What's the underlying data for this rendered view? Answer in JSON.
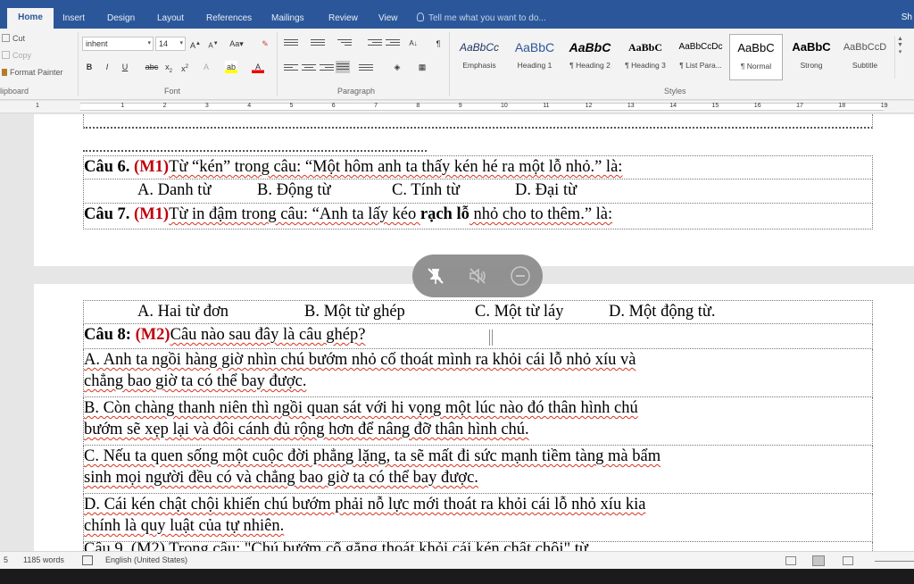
{
  "ribbon": {
    "tabs": [
      "Home",
      "Insert",
      "Design",
      "Layout",
      "References",
      "Mailings",
      "Review",
      "View"
    ],
    "active_tab": "Home",
    "tell_me": "Tell me what you want to do...",
    "share": "Sh",
    "clipboard": {
      "cut": "Cut",
      "copy": "Copy",
      "format_painter": "Format Painter",
      "label": "lipboard"
    },
    "font": {
      "name": "inhent",
      "size": "14",
      "label": "Font"
    },
    "paragraph": {
      "label": "Paragraph"
    },
    "styles": {
      "label": "Styles",
      "items": [
        {
          "preview": "AaBbCc",
          "name": "Emphasis"
        },
        {
          "preview": "AaBbC",
          "name": "Heading 1"
        },
        {
          "preview": "AaBbC",
          "name": "¶ Heading 2"
        },
        {
          "preview": "AaBbC",
          "name": "¶ Heading 3"
        },
        {
          "preview": "AaBbCcDc",
          "name": "¶ List Para..."
        },
        {
          "preview": "AaBbC",
          "name": "¶ Normal"
        },
        {
          "preview": "AaBbC",
          "name": "Strong"
        },
        {
          "preview": "AaBbCcD",
          "name": "Subtitle"
        }
      ],
      "selected": "¶ Normal"
    }
  },
  "ruler": {
    "numbers": [
      "1",
      "1",
      "2",
      "3",
      "4",
      "5",
      "6",
      "7",
      "8",
      "9",
      "10",
      "11",
      "12",
      "13",
      "14",
      "15",
      "16",
      "17",
      "18",
      "19"
    ]
  },
  "document": {
    "q6": {
      "prefix": "Câu 6. ",
      "level": "(M1)",
      "text": "Từ “kén” trong câu: “Một hôm anh ta thấy kén hé ra một lỗ nhỏ.” là:",
      "options": [
        "A. Danh từ",
        "B. Động từ",
        "C. Tính từ",
        "D. Đại từ"
      ]
    },
    "q7": {
      "prefix": "Câu 7. ",
      "level": "(M1)",
      "text_before": "Từ in đậm trong câu: “Anh ta lấy kéo ",
      "bold_text": "rạch lỗ",
      "text_after": " nhỏ cho to thêm.” là:",
      "options": [
        "A. Hai từ đơn",
        "B. Một từ ghép",
        "C. Một từ láy",
        "D. Một động từ."
      ]
    },
    "q8": {
      "prefix": "Câu 8: ",
      "level": "(M2)",
      "text": "Câu nào sau đây là câu ghép?",
      "options": [
        {
          "line1": "A. Anh ta ngồi hàng giờ nhìn chú bướm nhỏ cố thoát mình ra khỏi cái lỗ nhỏ xíu và",
          "line2": "chẳng bao giờ ta có thể bay được."
        },
        {
          "line1": "B. Còn chàng thanh niên thì ngồi quan sát với hi vọng một lúc nào đó thân hình chú",
          "line2": "bướm sẽ xẹp lại và đôi cánh đủ rộng hơn để nâng đỡ thân hình chú."
        },
        {
          "line1": "C. Nếu ta quen sống một cuộc đời phẳng lặng, ta sẽ mất đi sức mạnh tiềm tàng mà bẩm",
          "line2": "sinh mọi người đều có và chẳng bao giờ ta có thể bay được."
        },
        {
          "line1": "D. Cái kén chật chội khiến chú bướm phải nỗ lực mới thoát ra khỏi cái lỗ nhỏ xíu kia",
          "line2": "chính là quy luật của tự nhiên."
        }
      ],
      "cutoff_line": "Câu 9. (M2) Trong câu: \"Chú bướm cố gắng thoát khỏi cái kén chật chội\" từ"
    }
  },
  "status": {
    "page": "5",
    "words": "1185 words",
    "language": "English (United States)"
  }
}
